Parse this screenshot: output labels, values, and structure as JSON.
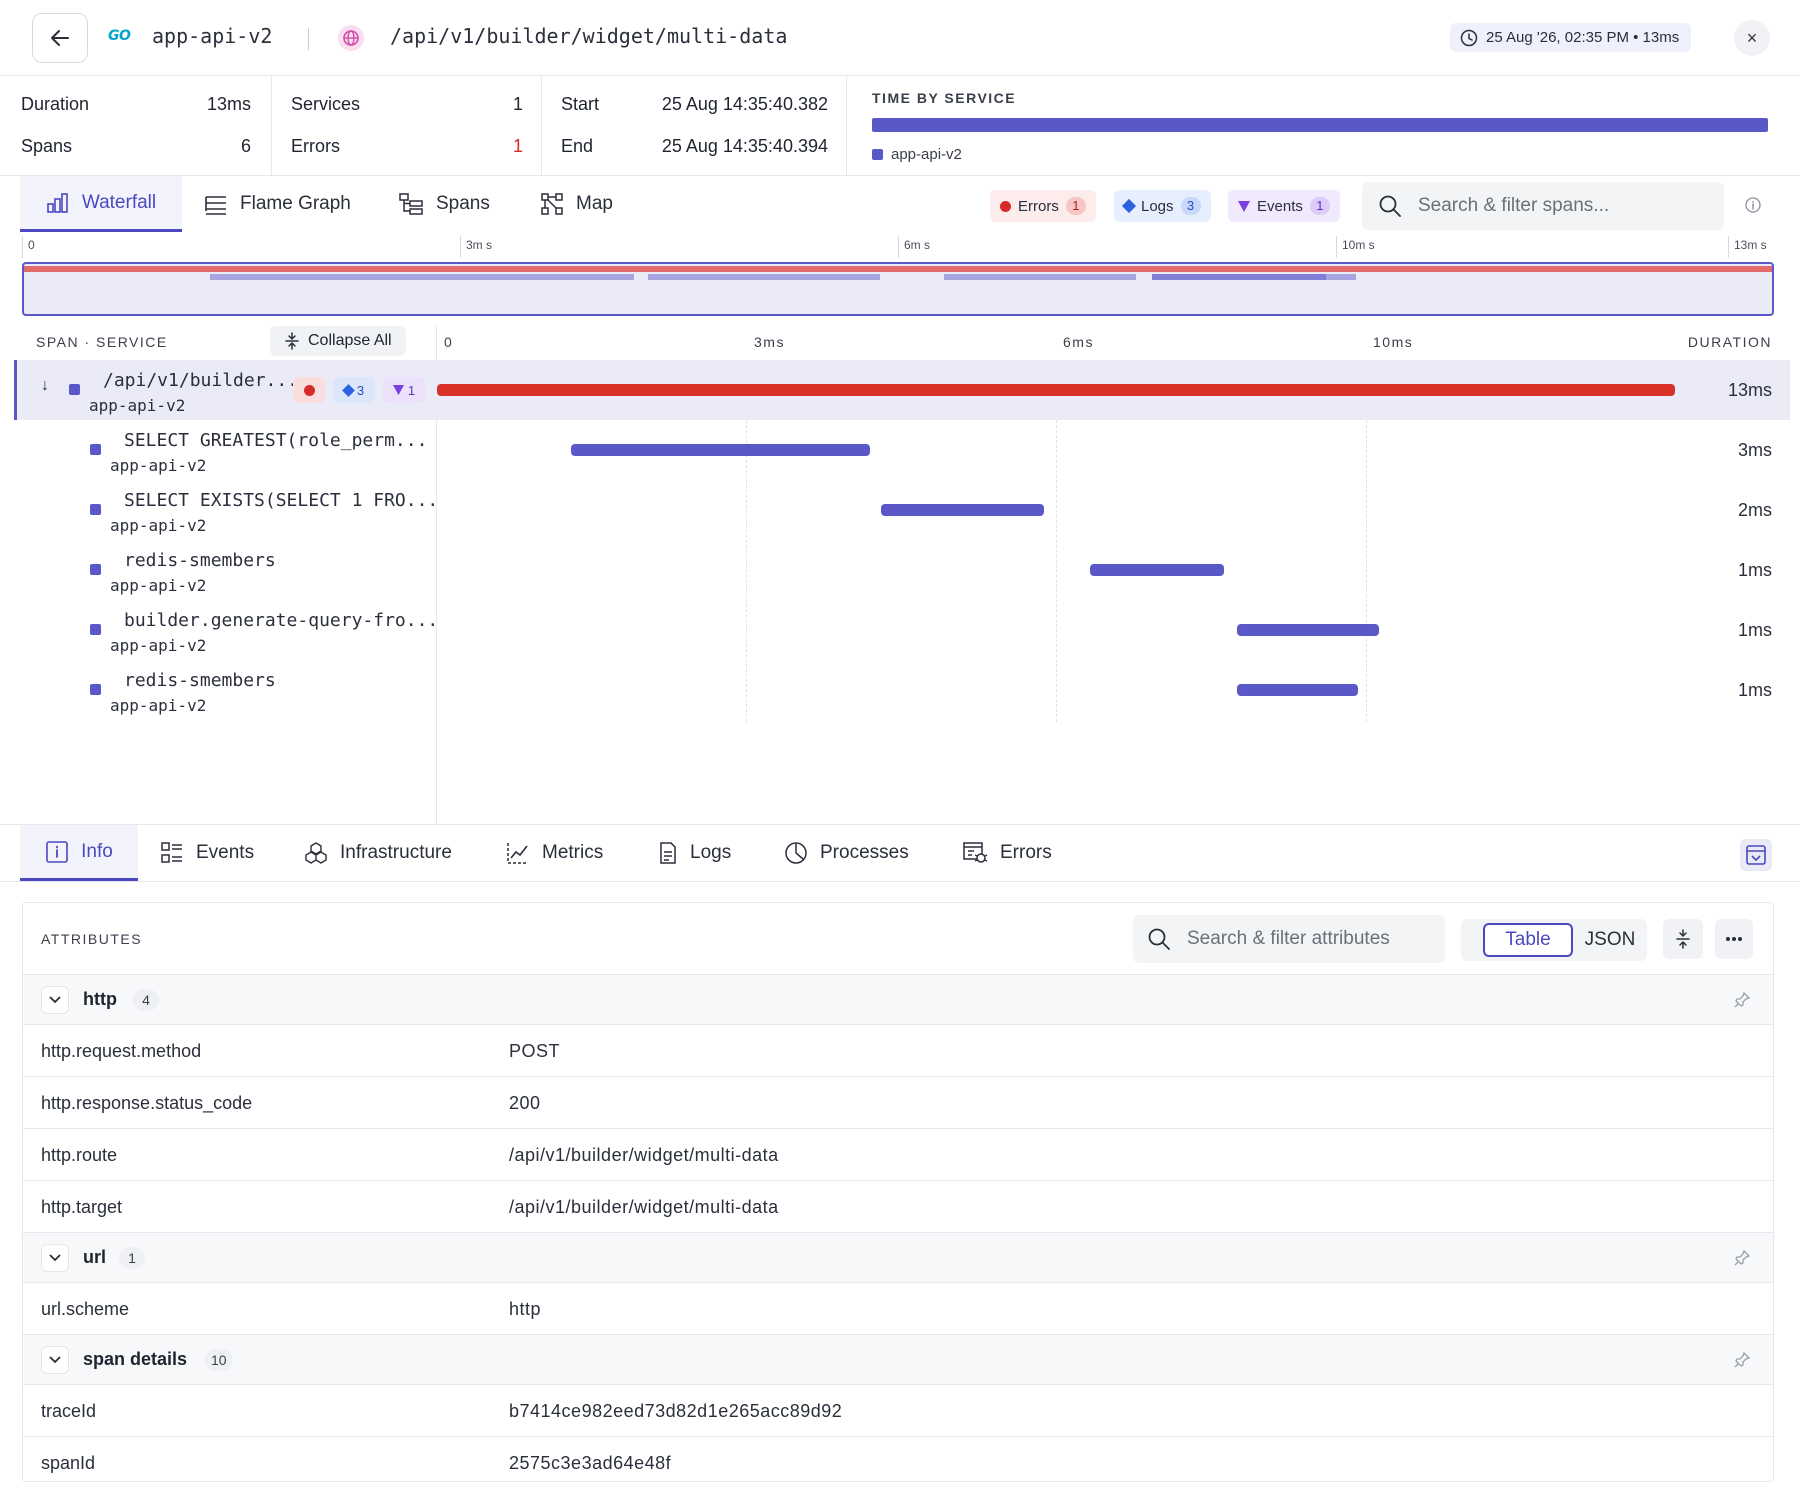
{
  "header": {
    "go_logo": "GO",
    "service": "app-api-v2",
    "route": "/api/v1/builder/widget/multi-data",
    "timestamp": "25 Aug '26, 02:35 PM • 13ms",
    "close": "×"
  },
  "summary": {
    "duration_label": "Duration",
    "duration_value": "13ms",
    "spans_label": "Spans",
    "spans_value": "6",
    "services_label": "Services",
    "services_value": "1",
    "errors_label": "Errors",
    "errors_value": "1",
    "start_label": "Start",
    "start_value": "25 Aug 14:35:40.382",
    "end_label": "End",
    "end_value": "25 Aug 14:35:40.394",
    "time_by_service_title": "TIME BY SERVICE",
    "time_by_service_legend": "app-api-v2",
    "service_color": "#5a57c9"
  },
  "tabs": [
    {
      "label": "Waterfall",
      "icon": "waterfall-icon",
      "active": true
    },
    {
      "label": "Flame Graph",
      "icon": "flame-graph-icon"
    },
    {
      "label": "Spans",
      "icon": "spans-tree-icon"
    },
    {
      "label": "Map",
      "icon": "map-icon"
    }
  ],
  "filters": {
    "errors_label": "Errors",
    "errors_count": "1",
    "logs_label": "Logs",
    "logs_count": "3",
    "events_label": "Events",
    "events_count": "1",
    "search_placeholder": "Search & filter spans..."
  },
  "minimap": {
    "ticks": [
      "0",
      "3m s",
      "6m s",
      "10m s",
      "13m s"
    ]
  },
  "waterfall": {
    "col_span_service": "SPAN · SERVICE",
    "collapse_all": "Collapse All",
    "col_duration": "DURATION",
    "ticks": [
      "0",
      "3ms",
      "6ms",
      "10ms"
    ],
    "total_ms": 12,
    "root_badges": {
      "logs": "3",
      "events": "1"
    },
    "spans": [
      {
        "name": "/api/v1/builder...",
        "service": "app-api-v2",
        "duration": "13ms",
        "start_ms": 0,
        "dur_ms": 12,
        "error": true
      },
      {
        "name": "SELECT GREATEST(role_perm...",
        "service": "app-api-v2",
        "duration": "3ms",
        "start_ms": 1.3,
        "dur_ms": 2.9
      },
      {
        "name": "SELECT EXISTS(SELECT 1 FRO...",
        "service": "app-api-v2",
        "duration": "2ms",
        "start_ms": 4.3,
        "dur_ms": 1.58
      },
      {
        "name": "redis-smembers",
        "service": "app-api-v2",
        "duration": "1ms",
        "start_ms": 6.33,
        "dur_ms": 1.3
      },
      {
        "name": "builder.generate-query-fro...",
        "service": "app-api-v2",
        "duration": "1ms",
        "start_ms": 7.75,
        "dur_ms": 1.38
      },
      {
        "name": "redis-smembers",
        "service": "app-api-v2",
        "duration": "1ms",
        "start_ms": 7.75,
        "dur_ms": 1.18
      }
    ]
  },
  "bottom_tabs": [
    {
      "label": "Info",
      "icon": "info-icon",
      "active": true
    },
    {
      "label": "Events",
      "icon": "events-icon"
    },
    {
      "label": "Infrastructure",
      "icon": "infrastructure-icon"
    },
    {
      "label": "Metrics",
      "icon": "metrics-icon"
    },
    {
      "label": "Logs",
      "icon": "logs-icon"
    },
    {
      "label": "Processes",
      "icon": "processes-icon"
    },
    {
      "label": "Errors",
      "icon": "errors-bug-icon"
    }
  ],
  "attributes": {
    "title": "ATTRIBUTES",
    "search_placeholder": "Search & filter attributes",
    "view_table": "Table",
    "view_json": "JSON",
    "groups": [
      {
        "name": "http",
        "count": "4",
        "rows": [
          {
            "key": "http.request.method",
            "value": "POST"
          },
          {
            "key": "http.response.status_code",
            "value": "200"
          },
          {
            "key": "http.route",
            "value": "/api/v1/builder/widget/multi-data"
          },
          {
            "key": "http.target",
            "value": "/api/v1/builder/widget/multi-data"
          }
        ]
      },
      {
        "name": "url",
        "count": "1",
        "rows": [
          {
            "key": "url.scheme",
            "value": "http"
          }
        ]
      },
      {
        "name": "span details",
        "count": "10",
        "rows": [
          {
            "key": "traceId",
            "value": "b7414ce982eed73d82d1e265acc89d92"
          },
          {
            "key": "spanId",
            "value": "2575c3e3ad64e48f"
          }
        ]
      }
    ]
  }
}
